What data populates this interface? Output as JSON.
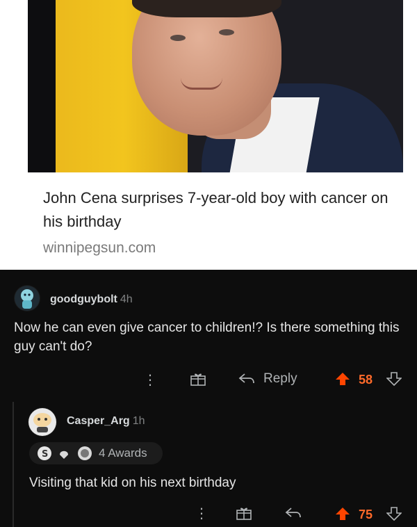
{
  "post": {
    "headline": "John Cena surprises 7-year-old boy with cancer on his birthday",
    "source": "winnipegsun.com"
  },
  "comments": [
    {
      "username": "goodguybolt",
      "age": "4h",
      "text": "Now he can even give cancer to children!? Is there something this guy can't do?",
      "reply_label": "Reply",
      "votes": "58"
    },
    {
      "username": "Casper_Arg",
      "age": "1h",
      "awards_label": "4 Awards",
      "text": "Visiting that kid on his next birthday",
      "votes": "75"
    }
  ],
  "colors": {
    "upvote": "#ff4500",
    "background": "#0d0d0d",
    "text": "#e6e6e6"
  }
}
